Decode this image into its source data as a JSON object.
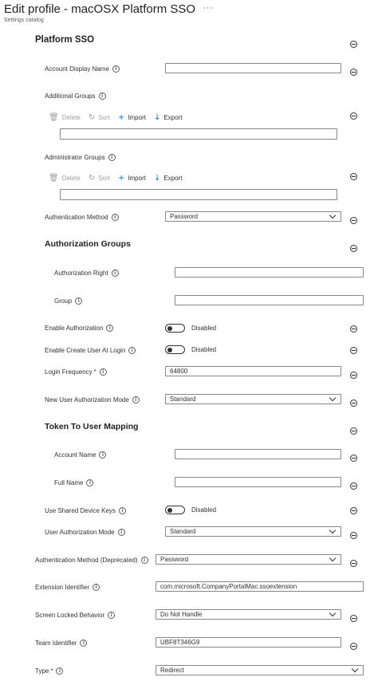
{
  "header": {
    "title": "Edit profile - macOSX Platform SSO",
    "more": "···",
    "subtitle": "Settings catalog"
  },
  "platform_sso": {
    "heading": "Platform SSO",
    "account_display_name": {
      "label": "Account Display Name",
      "value": ""
    },
    "additional_groups": {
      "label": "Additional Groups",
      "value": ""
    },
    "administrator_groups": {
      "label": "Administrator Groups",
      "value": ""
    },
    "authentication_method": {
      "label": "Authentication Method",
      "value": "Password"
    },
    "authorization_groups": {
      "heading": "Authorization Groups",
      "authorization_right": {
        "label": "Authorization Right",
        "value": ""
      },
      "group": {
        "label": "Group",
        "value": ""
      }
    },
    "enable_authorization": {
      "label": "Enable Authorization",
      "state": "Disabled"
    },
    "enable_create_user": {
      "label": "Enable Create User At Login",
      "state": "Disabled"
    },
    "login_frequency": {
      "label": "Login Frequency",
      "required": "*",
      "value": "64800"
    },
    "new_user_auth_mode": {
      "label": "New User Authorization Mode",
      "value": "Standard"
    },
    "token_mapping": {
      "heading": "Token To User Mapping",
      "account_name": {
        "label": "Account Name",
        "value": ""
      },
      "full_name": {
        "label": "Full Name",
        "value": ""
      }
    },
    "use_shared_device_keys": {
      "label": "Use Shared Device Keys",
      "state": "Disabled"
    },
    "user_auth_mode": {
      "label": "User Authorization Mode",
      "value": "Standard"
    }
  },
  "authentication_method_deprecated": {
    "label": "Authentication Method (Deprecated)",
    "value": "Password"
  },
  "extension_identifier": {
    "label": "Extension Identifier",
    "value": "com.microsoft.CompanyPortalMac.ssoextension"
  },
  "screen_locked_behavior": {
    "label": "Screen Locked Behavior",
    "value": "Do Not Handle"
  },
  "team_identifier": {
    "label": "Team Identifier",
    "value": "UBF8T346G9"
  },
  "type": {
    "label": "Type",
    "required": "*",
    "value": "Redirect"
  },
  "toolbar": {
    "delete": "Delete",
    "sort": "Sort",
    "import": "Import",
    "export": "Export"
  },
  "icons": {
    "info": "info-icon",
    "remove": "minus-circle-icon",
    "delete": "trash-icon",
    "sort": "sort-icon",
    "import": "plus-icon",
    "export": "download-icon",
    "dropdown": "chevron-down-icon"
  }
}
